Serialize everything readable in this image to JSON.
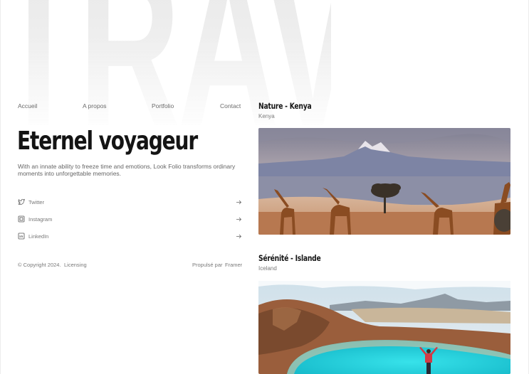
{
  "background_word": "TRAVELS",
  "nav": {
    "items": [
      "Accueil",
      "A propos",
      "Portfolio",
      "Contact"
    ]
  },
  "hero": {
    "title": "Eternel voyageur",
    "description": "With an innate ability to freeze time and emotions, Look Folio transforms ordinary moments into unforgettable memories."
  },
  "social": [
    {
      "label": "Twitter",
      "icon": "twitter-icon"
    },
    {
      "label": "Instagram",
      "icon": "instagram-icon"
    },
    {
      "label": "LinkedIn",
      "icon": "linkedin-icon"
    }
  ],
  "footer": {
    "copyright": "© Copyright 2024.",
    "licensing": "Licensing",
    "powered_prefix": "Propulsé par",
    "powered_brand": "Framer"
  },
  "cards": [
    {
      "title": "Nature - Kenya",
      "subtitle": "Kenya",
      "image": "giraffes-kilimanjaro-photo"
    },
    {
      "title": "Sérénité - Islande",
      "subtitle": "Iceland",
      "image": "turquoise-crater-lake-photo"
    }
  ],
  "colors": {
    "text_dark": "#141414",
    "text_muted": "#6b6b6b",
    "background": "#ffffff",
    "lake": "#2ad3dd"
  }
}
